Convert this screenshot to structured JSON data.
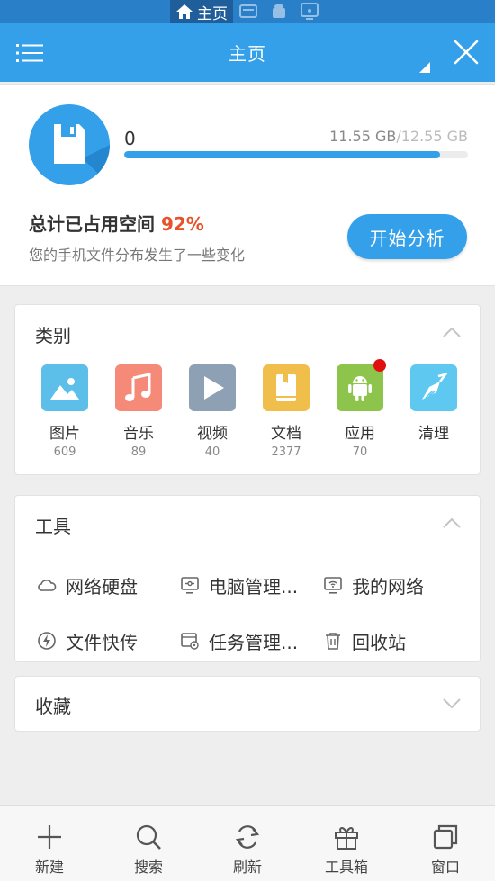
{
  "status_bar": {
    "home_label": "主页"
  },
  "app_bar": {
    "title": "主页"
  },
  "storage": {
    "used_count": "0",
    "used_size": "11.55 GB",
    "separator": "/",
    "total_size": "12.55 GB",
    "usage_ratio": 0.92,
    "usage_title": "总计已占用空间",
    "usage_percent": "92%",
    "subtitle": "您的手机文件分布发生了一些变化",
    "analyze_label": "开始分析"
  },
  "categories": {
    "title": "类别",
    "items": [
      {
        "label": "图片",
        "count": "609",
        "icon": "image-icon",
        "color": "#5bbfe9"
      },
      {
        "label": "音乐",
        "count": "89",
        "icon": "music-icon",
        "color": "#f58a78"
      },
      {
        "label": "视频",
        "count": "40",
        "icon": "video-icon",
        "color": "#8ea0b3"
      },
      {
        "label": "文档",
        "count": "2377",
        "icon": "document-icon",
        "color": "#f0be4a"
      },
      {
        "label": "应用",
        "count": "70",
        "icon": "android-icon",
        "color": "#8dc44b"
      },
      {
        "label": "清理",
        "count": "",
        "icon": "broom-icon",
        "color": "#5fc8f0"
      }
    ]
  },
  "tools": {
    "title": "工具",
    "items": [
      {
        "label": "网络硬盘",
        "icon": "cloud-icon"
      },
      {
        "label": "电脑管理...",
        "icon": "monitor-icon"
      },
      {
        "label": "我的网络",
        "icon": "wifi-screen-icon"
      },
      {
        "label": "文件快传",
        "icon": "bolt-icon"
      },
      {
        "label": "任务管理...",
        "icon": "task-manager-icon"
      },
      {
        "label": "回收站",
        "icon": "trash-icon"
      }
    ]
  },
  "favorites": {
    "title": "收藏"
  },
  "bottom_nav": [
    {
      "label": "新建",
      "icon": "plus-icon"
    },
    {
      "label": "搜索",
      "icon": "search-icon"
    },
    {
      "label": "刷新",
      "icon": "refresh-icon"
    },
    {
      "label": "工具箱",
      "icon": "gift-icon"
    },
    {
      "label": "窗口",
      "icon": "windows-icon"
    }
  ],
  "colors": {
    "accent": "#35a0ea",
    "status_bar": "#2a7fc9",
    "percent": "#e8522b",
    "badge": "#e01010"
  }
}
